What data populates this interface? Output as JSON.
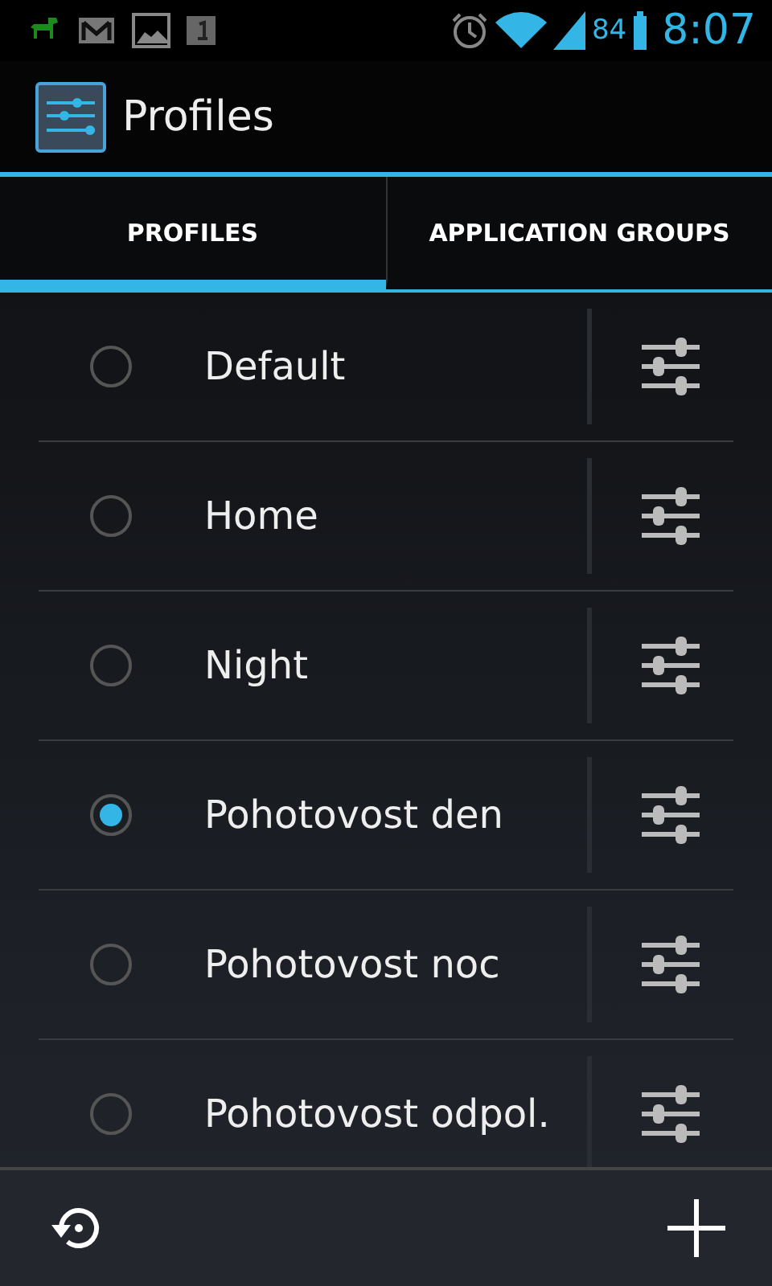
{
  "status_bar": {
    "battery_text": "84",
    "time": "8:07"
  },
  "action_bar": {
    "title": "Profiles"
  },
  "tabs": [
    {
      "label": "PROFILES",
      "selected": true
    },
    {
      "label": "APPLICATION GROUPS",
      "selected": false
    }
  ],
  "profiles": [
    {
      "name": "Default",
      "selected": false
    },
    {
      "name": "Home",
      "selected": false
    },
    {
      "name": "Night",
      "selected": false
    },
    {
      "name": "Pohotovost den",
      "selected": true
    },
    {
      "name": "Pohotovost noc",
      "selected": false
    },
    {
      "name": "Pohotovost odpol.",
      "selected": false
    }
  ]
}
